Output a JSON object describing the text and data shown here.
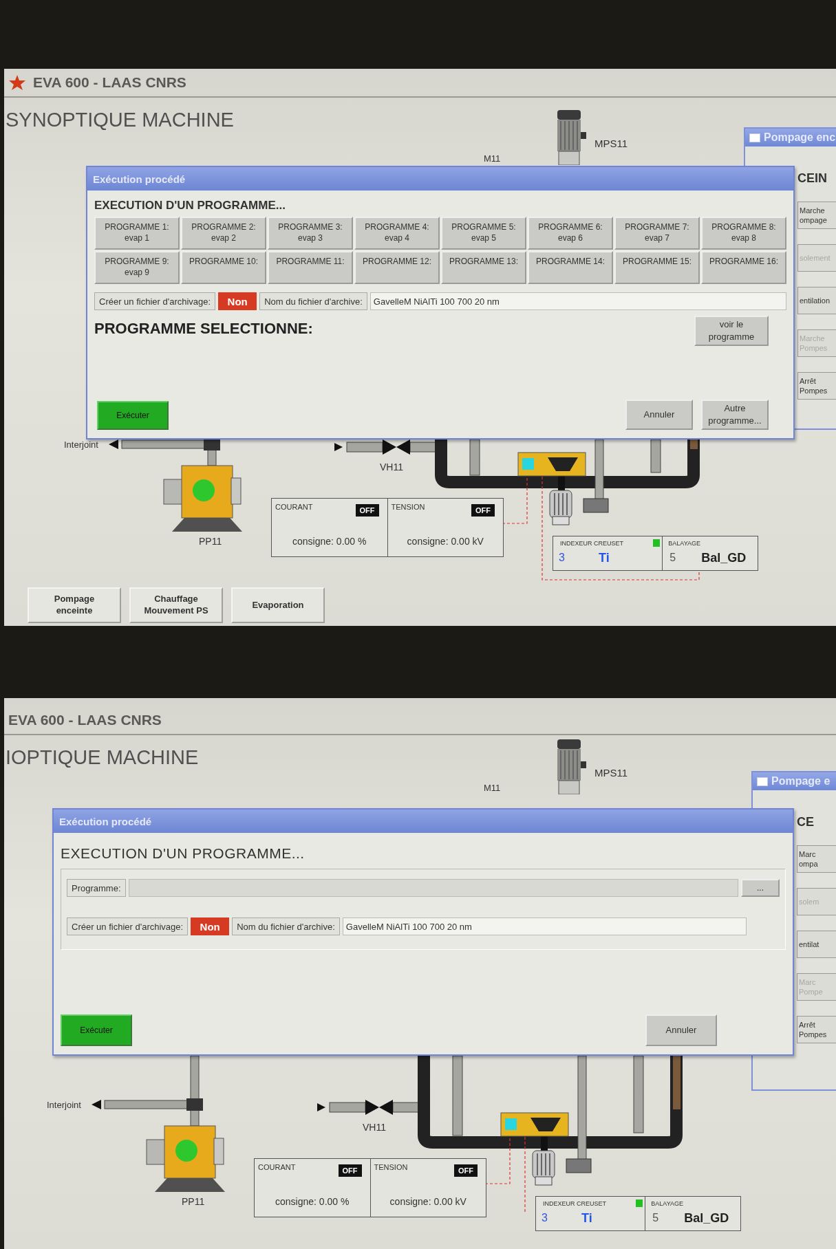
{
  "screens": [
    {
      "kind": "full",
      "app_title": "EVA 600 - LAAS CNRS",
      "page_title": "SYNOPTIQUE MACHINE",
      "diagram": {
        "motor_label": "MPS11",
        "motor2_label": "M11",
        "interjoint_label": "Interjoint",
        "valve_label": "VH11",
        "pump_label": "PP11",
        "power": [
          {
            "label": "COURANT",
            "state": "OFF",
            "setpoint": "consigne: 0.00 %"
          },
          {
            "label": "TENSION",
            "state": "OFF",
            "setpoint": "consigne: 0.00 kV"
          }
        ],
        "crucible": {
          "label": "INDEXEUR CREUSET",
          "number": "3",
          "material": "Ti"
        },
        "sweep": {
          "label": "BALAYAGE",
          "number": "5",
          "pattern": "Bal_GD"
        }
      },
      "side_panel": {
        "title": "Pompage enc",
        "heading": "CEIN",
        "buttons": [
          {
            "label": "Marche\nompage",
            "disabled": false
          },
          {
            "label": "solement",
            "disabled": true
          },
          {
            "label": "entilation",
            "disabled": false
          },
          {
            "label": "Marche\nPompes",
            "disabled": true
          },
          {
            "label": "Arrêt\nPompes",
            "disabled": false
          }
        ]
      },
      "dialog": {
        "kind": "grid",
        "title": "Exécution procédé",
        "heading": "EXECUTION D'UN PROGRAMME...",
        "programs": [
          {
            "label": "PROGRAMME 1:",
            "sub": "evap 1"
          },
          {
            "label": "PROGRAMME 2:",
            "sub": "evap 2"
          },
          {
            "label": "PROGRAMME 3:",
            "sub": "evap 3"
          },
          {
            "label": "PROGRAMME 4:",
            "sub": "evap 4"
          },
          {
            "label": "PROGRAMME 5:",
            "sub": "evap 5"
          },
          {
            "label": "PROGRAMME 6:",
            "sub": "evap 6"
          },
          {
            "label": "PROGRAMME 7:",
            "sub": "evap 7"
          },
          {
            "label": "PROGRAMME 8:",
            "sub": "evap 8"
          },
          {
            "label": "PROGRAMME 9:",
            "sub": "evap 9"
          },
          {
            "label": "PROGRAMME 10:"
          },
          {
            "label": "PROGRAMME 11:"
          },
          {
            "label": "PROGRAMME 12:"
          },
          {
            "label": "PROGRAMME 13:"
          },
          {
            "label": "PROGRAMME 14:"
          },
          {
            "label": "PROGRAMME 15:"
          },
          {
            "label": "PROGRAMME 16:"
          }
        ],
        "archive_label": "Créer un fichier d'archivage:",
        "archive_toggle": "Non",
        "filename_label": "Nom du fichier d'archive:",
        "filename": "GavelleM NiAlTi 100 700 20 nm",
        "selected_heading": "PROGRAMME SELECTIONNE:",
        "view_button": "voir le\nprogramme",
        "run_button": "Exécuter",
        "cancel_button": "Annuler",
        "other_button": "Autre\nprogramme..."
      },
      "bottom_tabs": [
        {
          "label": "Pompage\nenceinte"
        },
        {
          "label": "Chauffage\nMouvement PS"
        },
        {
          "label": "Evaporation"
        }
      ]
    },
    {
      "kind": "shifted",
      "app_title": "EVA 600 - LAAS CNRS",
      "page_title": "IOPTIQUE MACHINE",
      "diagram": {
        "motor_label": "MPS11",
        "motor2_label": "M11",
        "interjoint_label": "Interjoint",
        "valve_label": "VH11",
        "pump_label": "PP11",
        "power": [
          {
            "label": "COURANT",
            "state": "OFF",
            "setpoint": "consigne: 0.00 %"
          },
          {
            "label": "TENSION",
            "state": "OFF",
            "setpoint": "consigne: 0.00 kV"
          }
        ],
        "crucible": {
          "label": "INDEXEUR CREUSET",
          "number": "3",
          "material": "Ti"
        },
        "sweep": {
          "label": "BALAYAGE",
          "number": "5",
          "pattern": "Bal_GD"
        }
      },
      "side_panel": {
        "title": "Pompage e",
        "heading": "CE",
        "buttons": [
          {
            "label": "Marc\nompa",
            "disabled": false
          },
          {
            "label": "solem",
            "disabled": true
          },
          {
            "label": "entilat",
            "disabled": false
          },
          {
            "label": "Marc\nPompe",
            "disabled": true
          },
          {
            "label": "Arrêt\nPompes",
            "disabled": false
          }
        ]
      },
      "dialog": {
        "kind": "field",
        "title": "Exécution procédé",
        "heading": "EXECUTION D'UN PROGRAMME...",
        "program_label": "Programme:",
        "browse_button": "...",
        "archive_label": "Créer un fichier d'archivage:",
        "archive_toggle": "Non",
        "filename_label": "Nom du fichier d'archive:",
        "filename": "GavelleM NiAlTi 100 700 20 nm",
        "run_button": "Exécuter",
        "cancel_button": "Annuler"
      }
    }
  ]
}
